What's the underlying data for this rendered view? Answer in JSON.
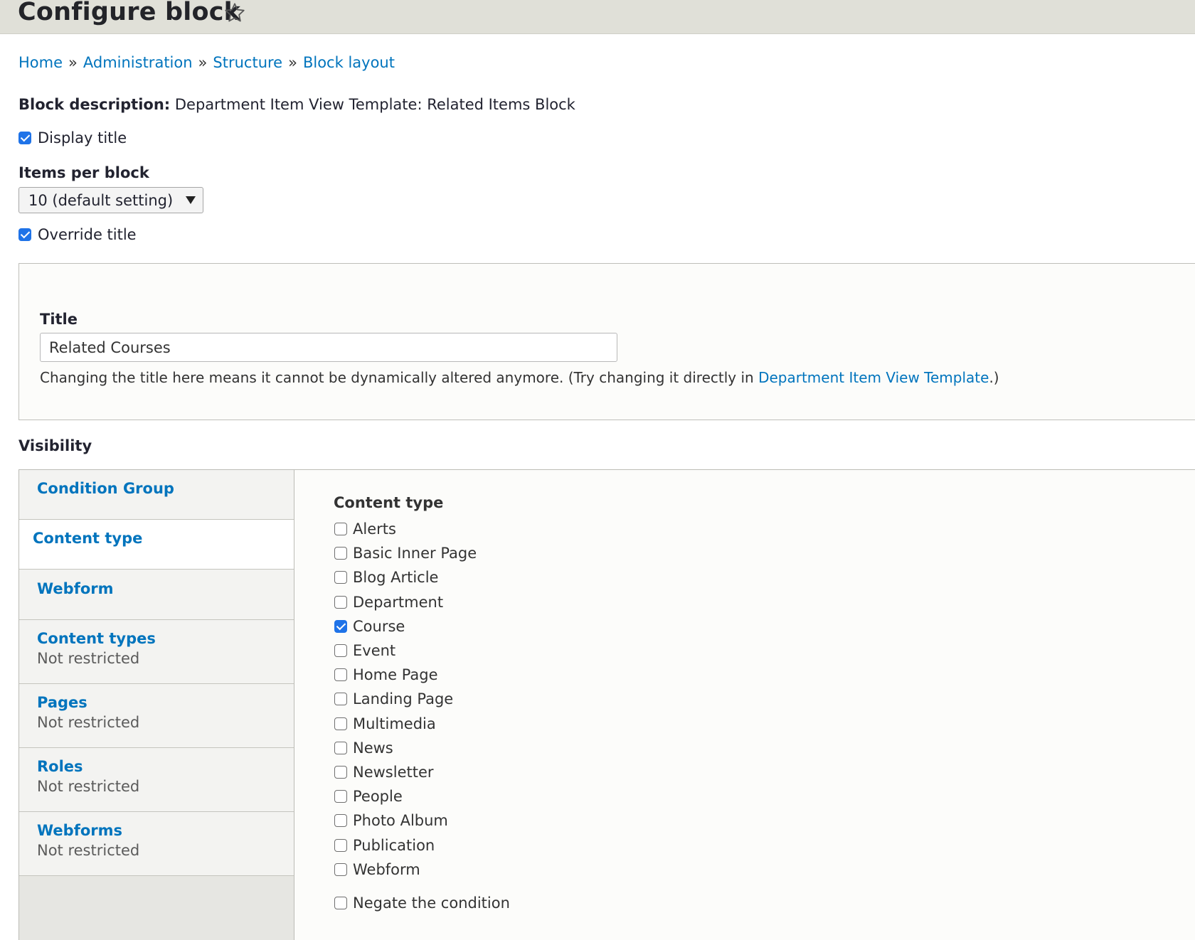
{
  "header": {
    "title": "Configure block",
    "favorite_icon": "star-icon"
  },
  "breadcrumb": {
    "items": [
      "Home",
      "Administration",
      "Structure",
      "Block layout"
    ],
    "separator": "»"
  },
  "block_description": {
    "label": "Block description:",
    "value": "Department Item View Template: Related Items Block"
  },
  "display_title": {
    "label": "Display title",
    "checked": true
  },
  "items_per_block": {
    "label": "Items per block",
    "selected": "10 (default setting)"
  },
  "override_title": {
    "label": "Override title",
    "checked": true
  },
  "title_field": {
    "label": "Title",
    "value": "Related Courses",
    "help_prefix": "Changing the title here means it cannot be dynamically altered anymore. (Try changing it directly in ",
    "help_link": "Department Item View Template",
    "help_suffix": ".)"
  },
  "visibility": {
    "heading": "Visibility",
    "tabs": [
      {
        "title": "Condition Group",
        "summary": ""
      },
      {
        "title": "Content type",
        "summary": "",
        "active": true
      },
      {
        "title": "Webform",
        "summary": ""
      },
      {
        "title": "Content types",
        "summary": "Not restricted"
      },
      {
        "title": "Pages",
        "summary": "Not restricted"
      },
      {
        "title": "Roles",
        "summary": "Not restricted"
      },
      {
        "title": "Webforms",
        "summary": "Not restricted"
      }
    ],
    "content_type": {
      "heading": "Content type",
      "options": [
        {
          "label": "Alerts",
          "checked": false
        },
        {
          "label": "Basic Inner Page",
          "checked": false
        },
        {
          "label": "Blog Article",
          "checked": false
        },
        {
          "label": "Department",
          "checked": false
        },
        {
          "label": "Course",
          "checked": true
        },
        {
          "label": "Event",
          "checked": false
        },
        {
          "label": "Home Page",
          "checked": false
        },
        {
          "label": "Landing Page",
          "checked": false
        },
        {
          "label": "Multimedia",
          "checked": false
        },
        {
          "label": "News",
          "checked": false
        },
        {
          "label": "Newsletter",
          "checked": false
        },
        {
          "label": "People",
          "checked": false
        },
        {
          "label": "Photo Album",
          "checked": false
        },
        {
          "label": "Publication",
          "checked": false
        },
        {
          "label": "Webform",
          "checked": false
        }
      ],
      "negate": {
        "label": "Negate the condition",
        "checked": false
      }
    }
  }
}
